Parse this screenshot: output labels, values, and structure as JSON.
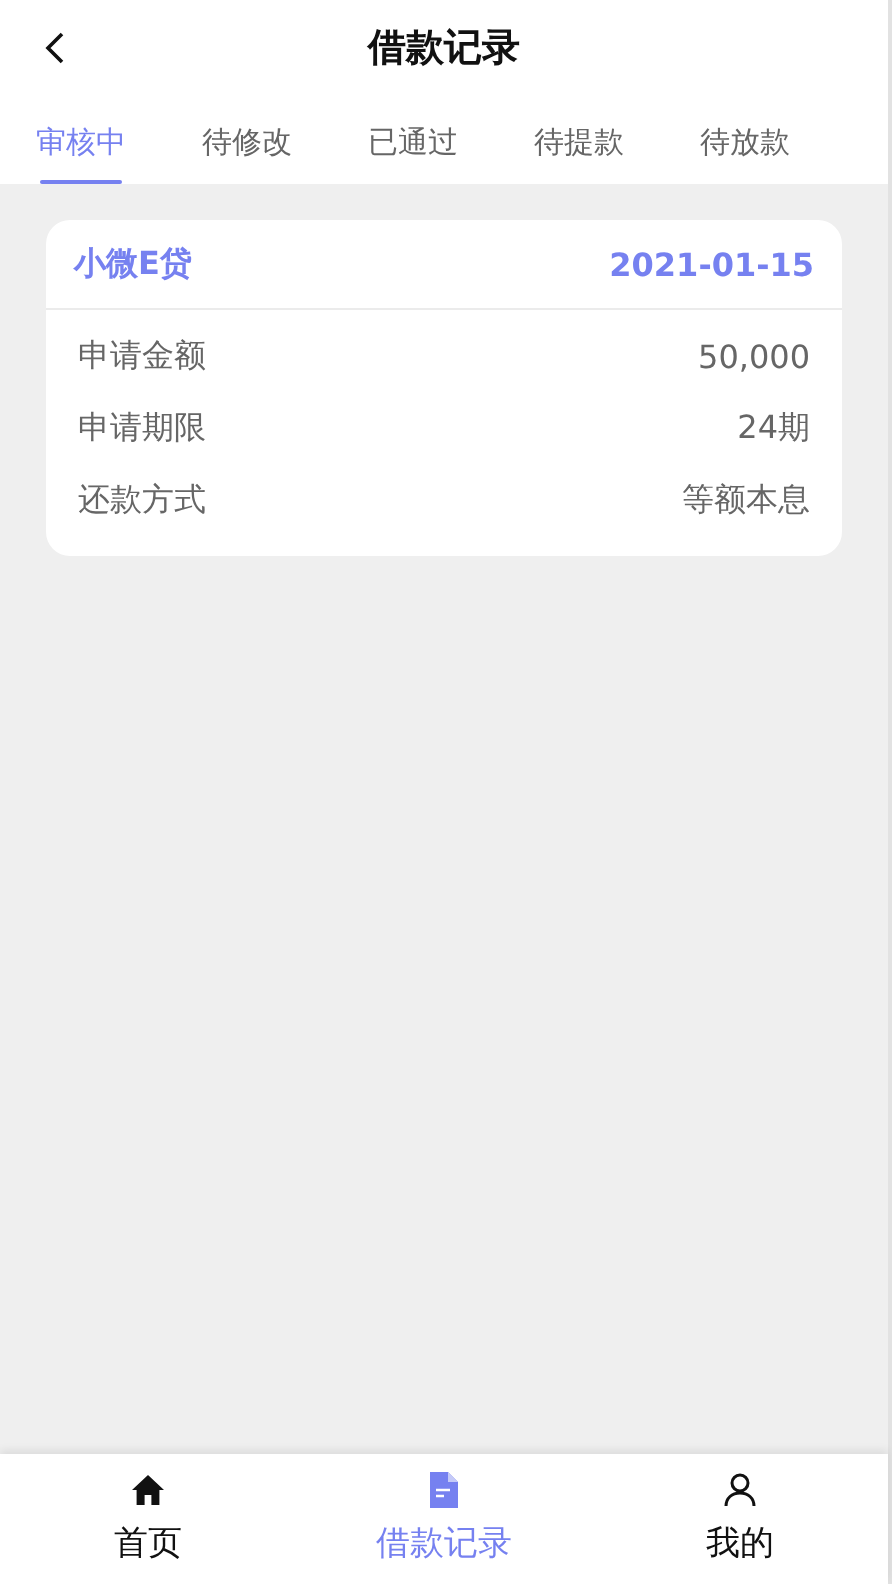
{
  "header": {
    "title": "借款记录"
  },
  "tabs": [
    {
      "label": "审核中",
      "selected": true
    },
    {
      "label": "待修改",
      "selected": false
    },
    {
      "label": "已通过",
      "selected": false
    },
    {
      "label": "待提款",
      "selected": false
    },
    {
      "label": "待放款",
      "selected": false
    }
  ],
  "records": [
    {
      "product": "小微E贷",
      "date": "2021-01-15",
      "fields": [
        {
          "label": "申请金额",
          "value": "50,000"
        },
        {
          "label": "申请期限",
          "value": "24期"
        },
        {
          "label": "还款方式",
          "value": "等额本息"
        }
      ]
    }
  ],
  "bottom_nav": [
    {
      "label": "首页",
      "kind": "home",
      "selected": false
    },
    {
      "label": "借款记录",
      "kind": "document",
      "selected": true
    },
    {
      "label": "我的",
      "kind": "person",
      "selected": false
    }
  ]
}
